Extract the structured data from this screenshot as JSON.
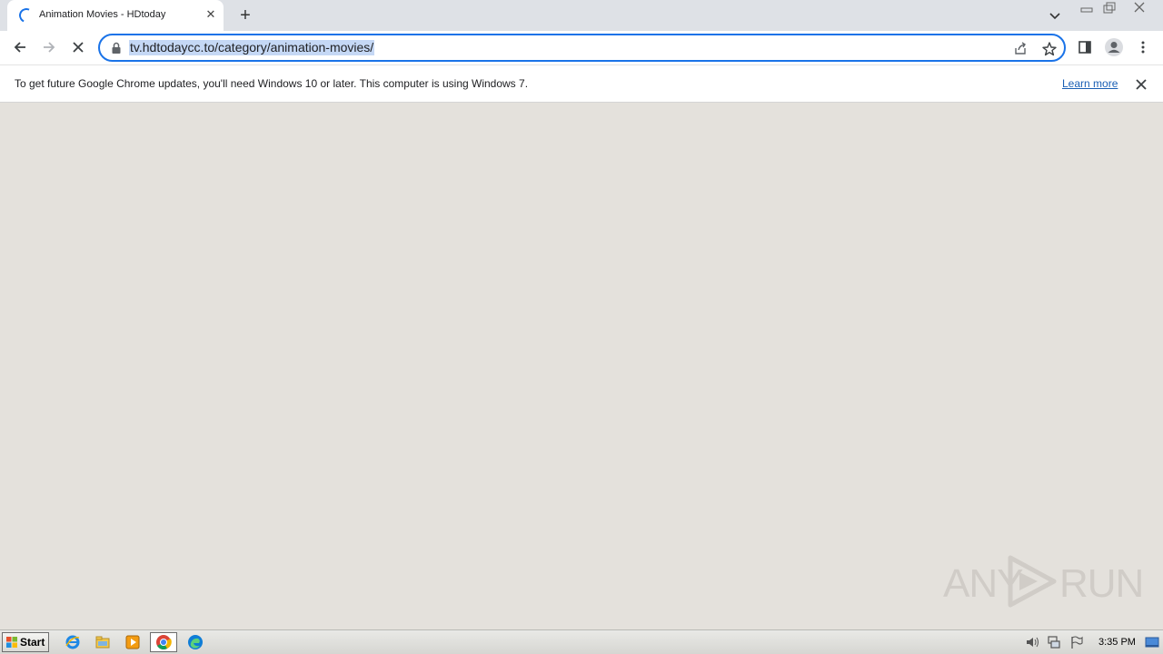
{
  "browser": {
    "tab": {
      "title": "Animation Movies - HDtoday",
      "loading": true
    },
    "url": "tv.hdtodaycc.to/category/animation-movies/",
    "accent_color": "#1a73e8"
  },
  "infobar": {
    "message": "To get future Google Chrome updates, you'll need Windows 10 or later. This computer is using Windows 7.",
    "link_label": "Learn more"
  },
  "watermark": {
    "left": "ANY",
    "right": "RUN"
  },
  "taskbar": {
    "start_label": "Start",
    "pinned": [
      "internet-explorer-icon",
      "file-explorer-icon",
      "media-player-icon",
      "chrome-icon",
      "edge-icon"
    ],
    "tray": [
      "volume-icon",
      "network-icon",
      "action-center-flag-icon",
      "show-desktop-icon"
    ],
    "clock": "3:35 PM"
  },
  "colors": {
    "content_background": "#e4e1dc",
    "tabstrip_background": "#dee1e6",
    "link": "#1a5fb4"
  }
}
